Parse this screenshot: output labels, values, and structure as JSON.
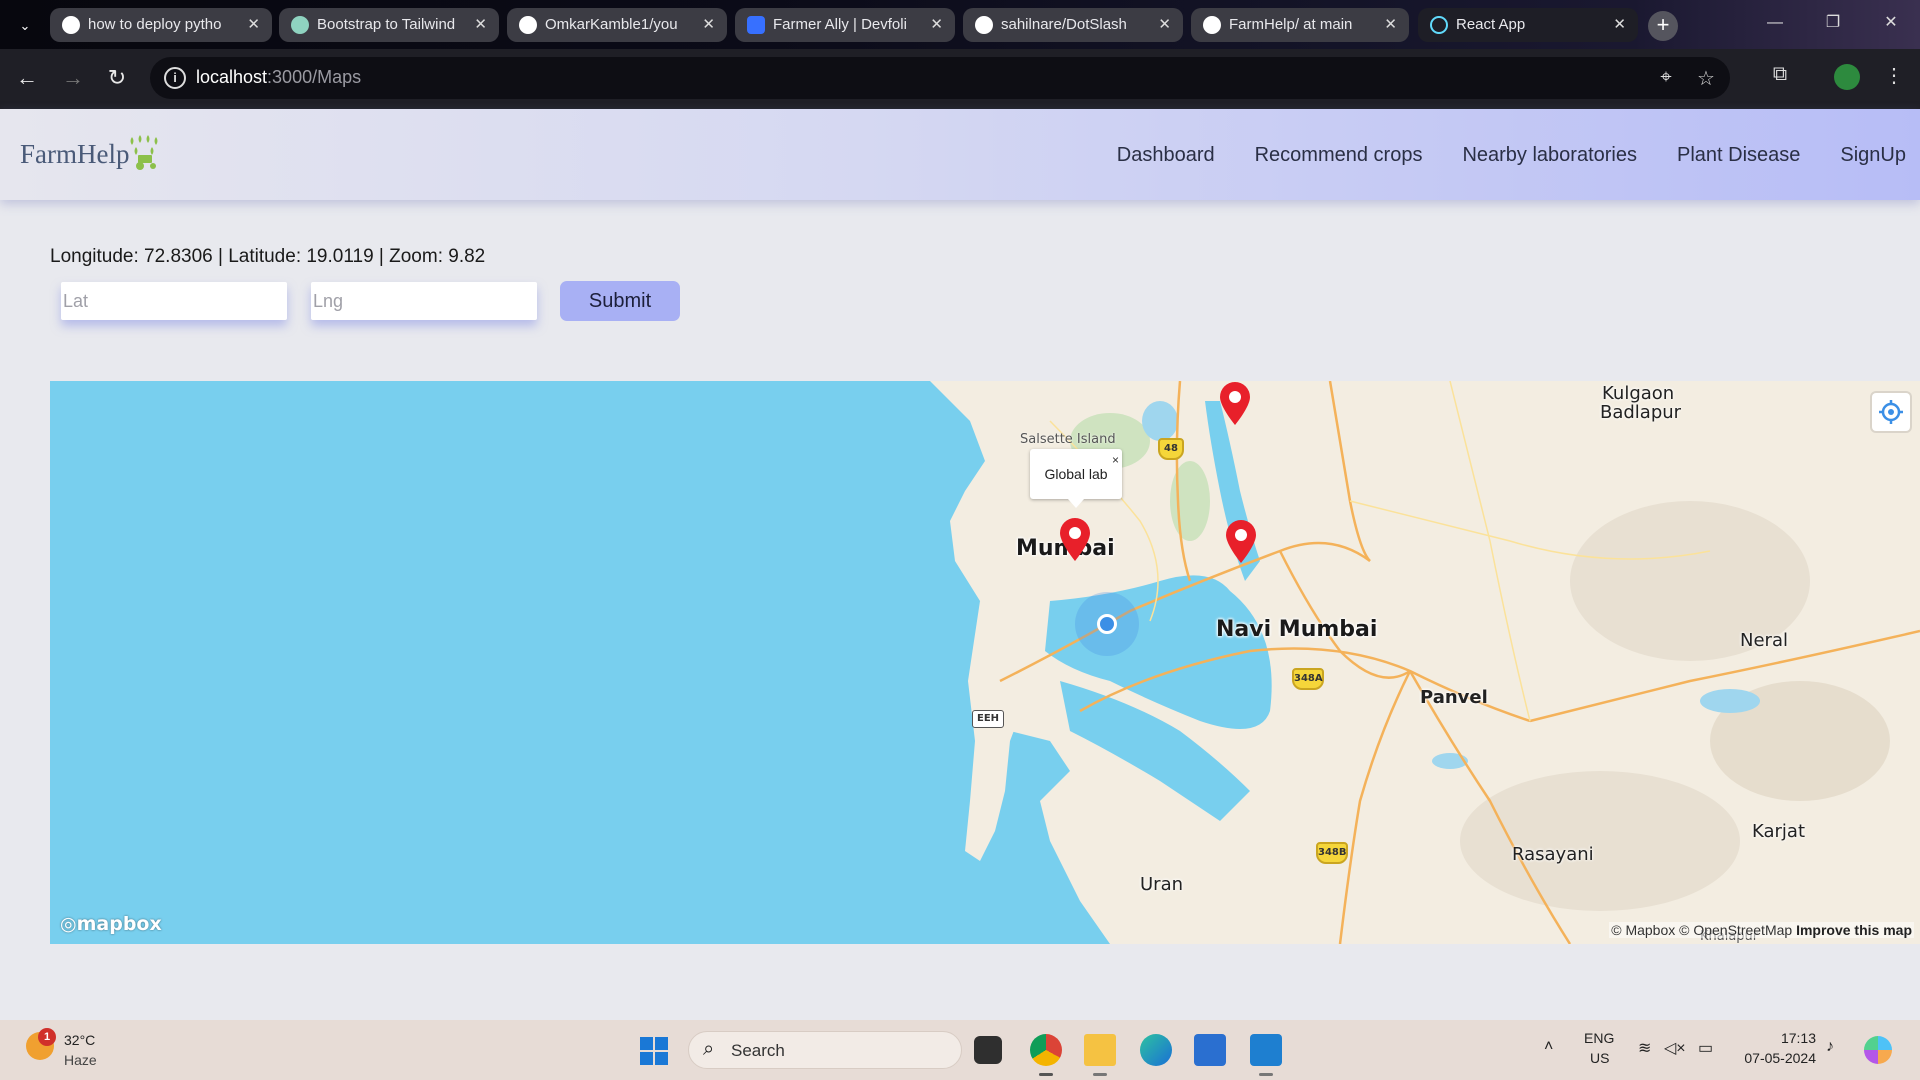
{
  "browser": {
    "tabs": [
      {
        "title": "how to deploy pytho",
        "favicon": "google-icon",
        "color": "#ffffff"
      },
      {
        "title": "Bootstrap to Tailwind",
        "favicon": "chatgpt-icon",
        "color": "#8fd3c0"
      },
      {
        "title": "OmkarKamble1/you",
        "favicon": "github-icon",
        "color": "#ffffff"
      },
      {
        "title": "Farmer Ally | Devfoli",
        "favicon": "devfolio-icon",
        "color": "#3770ff"
      },
      {
        "title": "sahilnare/DotSlash",
        "favicon": "github-icon",
        "color": "#ffffff"
      },
      {
        "title": "FarmHelp/ at main",
        "favicon": "github-icon",
        "color": "#ffffff"
      },
      {
        "title": "React App",
        "favicon": "react-icon",
        "color": "#61dafb"
      }
    ],
    "url_host": "localhost",
    "url_path": ":3000/Maps"
  },
  "app": {
    "brand": "FarmHelp",
    "nav": [
      "Dashboard",
      "Recommend crops",
      "Nearby laboratories",
      "Plant Disease",
      "SignUp"
    ],
    "coords_text": "Longitude: 72.8306 | Latitude: 19.0119 | Zoom: 9.82",
    "lat_placeholder": "Lat",
    "lng_placeholder": "Lng",
    "submit_label": "Submit"
  },
  "map": {
    "labels": {
      "salsette": "Salsette Island",
      "mumbai": "Mumbai",
      "navi_mumbai": "Navi Mumbai",
      "panvel": "Panvel",
      "kulgaon": "Kulgaon",
      "badlapur": "Badlapur",
      "neral": "Neral",
      "karjat": "Karjat",
      "rasayani": "Rasayani",
      "uran": "Uran",
      "khalapur": "Khalapur"
    },
    "shields": {
      "r48": "48",
      "r348a": "348A",
      "r348b": "348B",
      "eeh": "EEH"
    },
    "popup_text": "Global lab",
    "popup_close": "×",
    "logo_text": "mapbox",
    "attribution": "© Mapbox © OpenStreetMap",
    "improve": "Improve this map",
    "colors": {
      "water": "#78cfee",
      "land": "#f3ede1",
      "pin": "#e8202a",
      "user": "#3b8fe6"
    }
  },
  "taskbar": {
    "temp": "32°C",
    "condition": "Haze",
    "badge": "1",
    "search_placeholder": "Search",
    "lang1": "ENG",
    "lang2": "US",
    "time": "17:13",
    "date": "07-05-2024"
  }
}
